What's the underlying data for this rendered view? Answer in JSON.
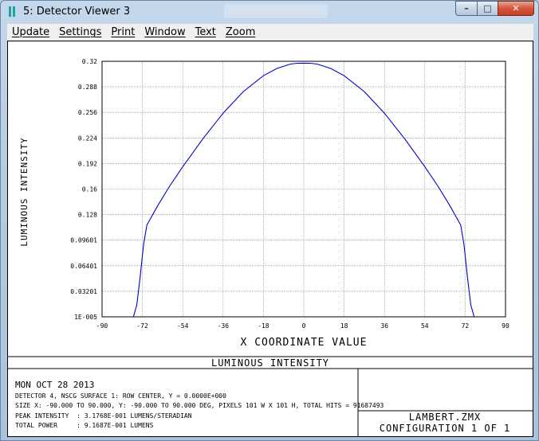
{
  "window": {
    "title": "5: Detector Viewer 3"
  },
  "caption_buttons": {
    "minimize": "–",
    "maximize": "□",
    "close": "✕"
  },
  "menu": [
    "Update",
    "Settings",
    "Print",
    "Window",
    "Text",
    "Zoom"
  ],
  "colors": {
    "curve": "#0000cc",
    "grid": "#808080",
    "titlebar": "#b4cbe3"
  },
  "chart_data": {
    "type": "line",
    "xlabel": "X COORDINATE VALUE",
    "ylabel": "LUMINOUS INTENSITY",
    "xlim": [
      -90,
      90
    ],
    "ylim": [
      0,
      0.32
    ],
    "xticks": [
      -90,
      -72,
      -54,
      -36,
      -18,
      0,
      18,
      36,
      54,
      72,
      90
    ],
    "ytick_labels": [
      "1E-005",
      "0.03201",
      "0.06401",
      "0.09601",
      "0.128",
      "0.16",
      "0.192",
      "0.224",
      "0.256",
      "0.288",
      "0.32"
    ],
    "grid": true,
    "series": [
      {
        "x": [
          -76,
          -74.5,
          -73,
          -71.5,
          -70,
          -68,
          -65,
          -60,
          -54,
          -45,
          -36,
          -27,
          -18,
          -12,
          -6,
          -3,
          0,
          3,
          6,
          12,
          18,
          27,
          36,
          45,
          54,
          60,
          65,
          68,
          70,
          71.5,
          73,
          74.5,
          76
        ],
        "y": [
          0,
          0.015,
          0.05,
          0.09,
          0.115,
          0.125,
          0.14,
          0.163,
          0.188,
          0.223,
          0.255,
          0.282,
          0.302,
          0.311,
          0.3165,
          0.3175,
          0.3176,
          0.3175,
          0.3165,
          0.311,
          0.302,
          0.282,
          0.255,
          0.223,
          0.188,
          0.163,
          0.14,
          0.125,
          0.115,
          0.09,
          0.05,
          0.015,
          0
        ]
      }
    ]
  },
  "panel": {
    "heading": "LUMINOUS INTENSITY",
    "date": "MON OCT 28 2013",
    "line1": "DETECTOR 4, NSCG SURFACE 1: ROW CENTER, Y = 0.0000E+000",
    "line2": "SIZE X: -90.000 TO 90.000, Y: -90.000 TO 90.000 DEG, PIXELS 101 W X 101 H, TOTAL HITS = 91687493",
    "line3": "PEAK INTENSITY  : 3.1768E-001 LUMENS/STERADIAN",
    "line4": "TOTAL POWER     : 9.1687E-001 LUMENS",
    "file": "LAMBERT.ZMX",
    "config": "CONFIGURATION 1 OF 1"
  }
}
